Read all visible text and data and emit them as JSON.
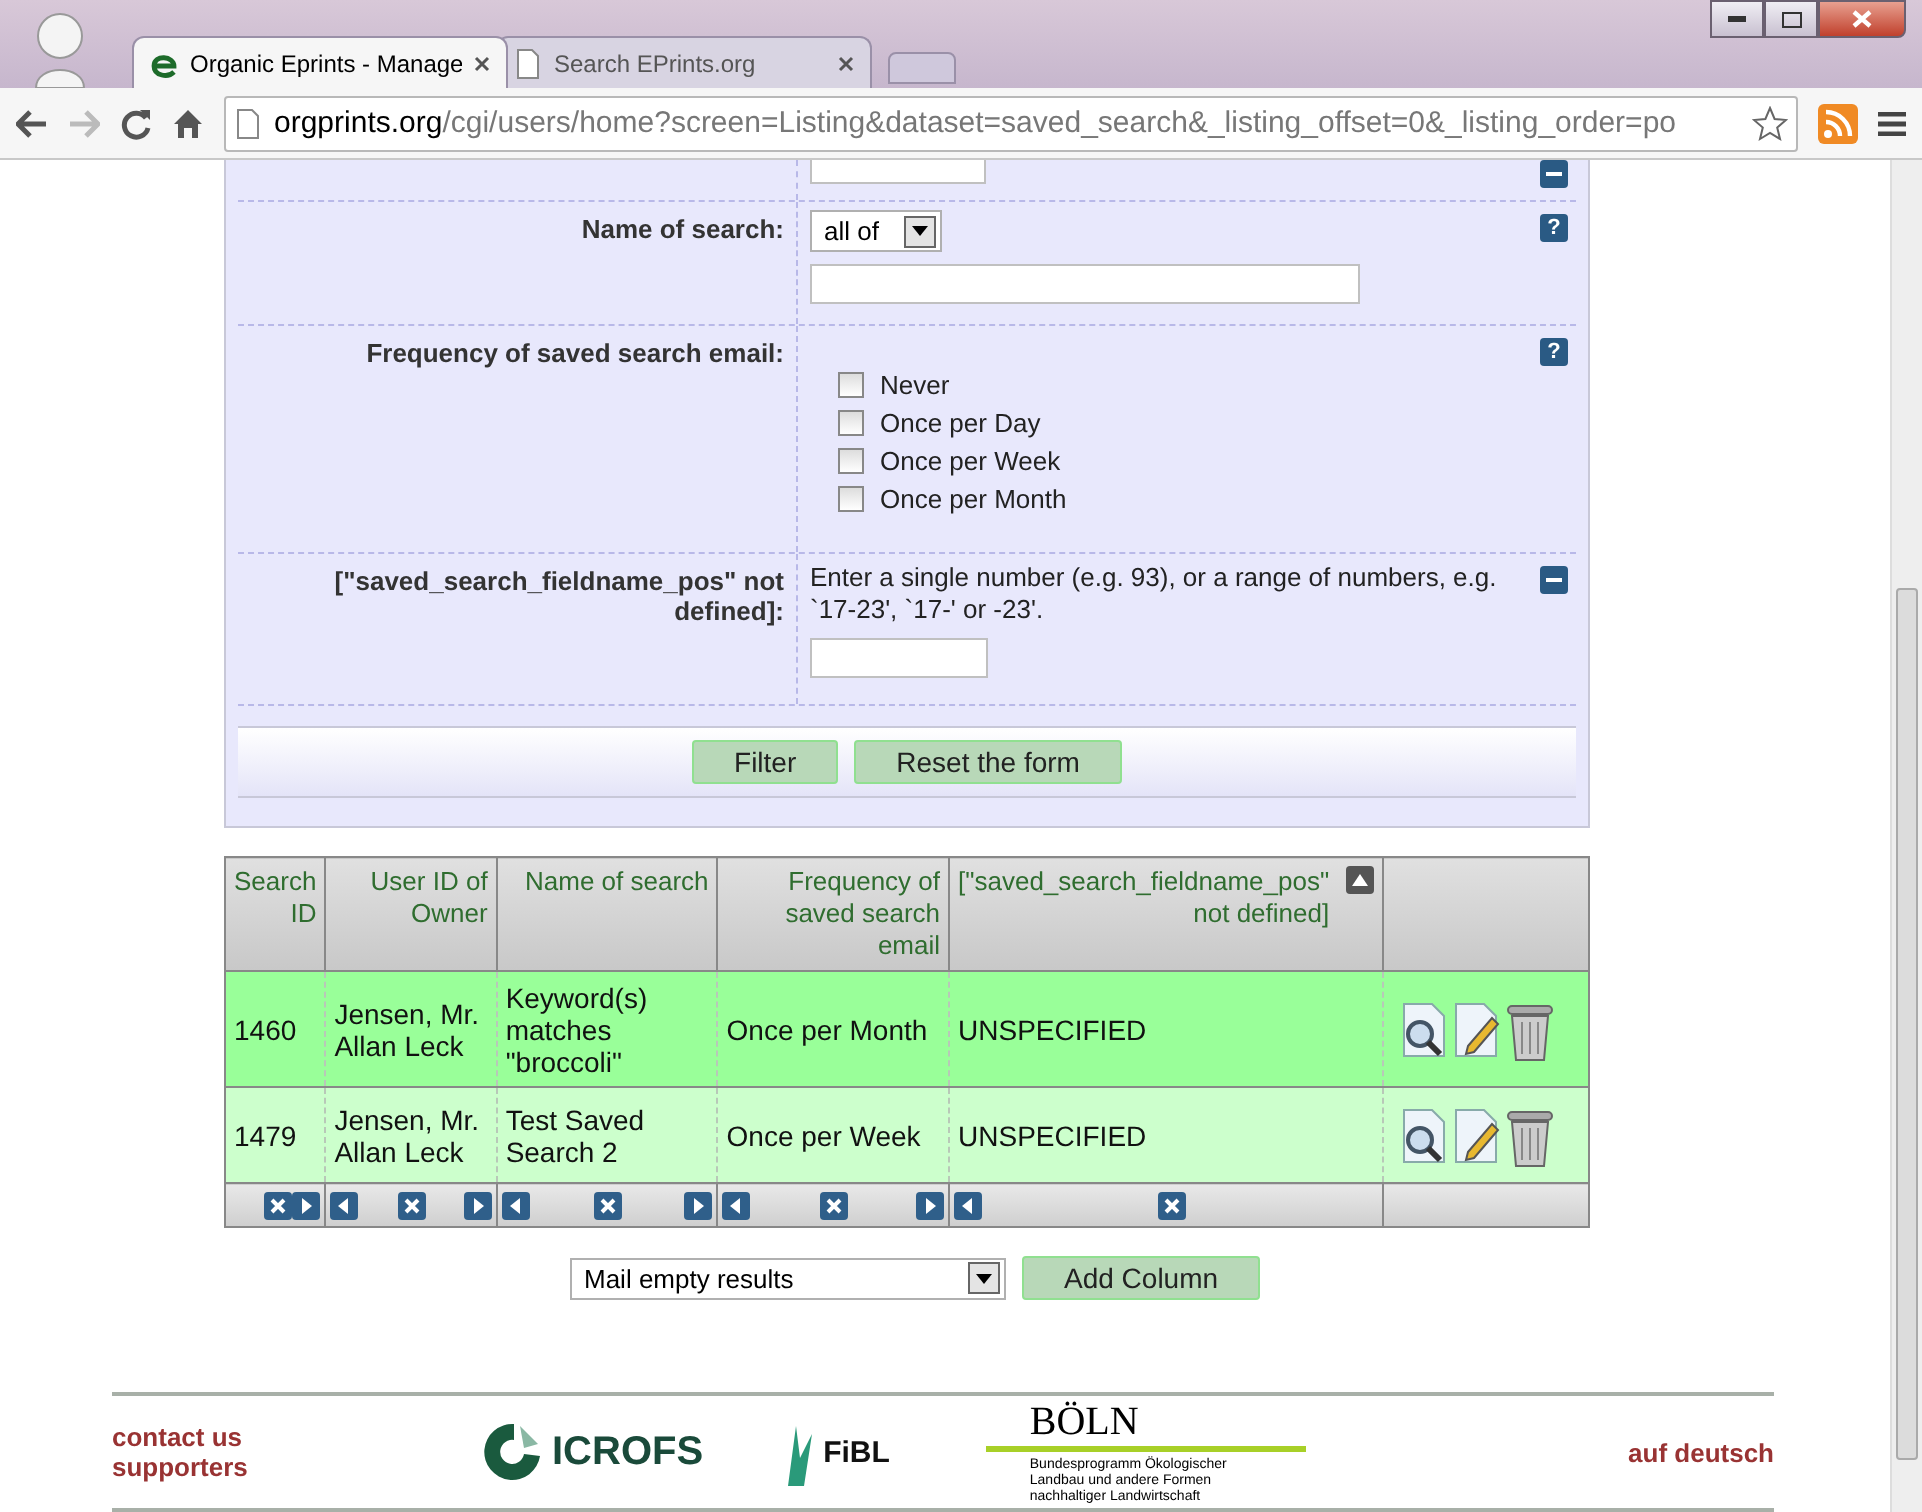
{
  "browser": {
    "tabs": [
      {
        "title": "Organic Eprints - Manage",
        "selected": true
      },
      {
        "title": "Search EPrints.org",
        "selected": false
      }
    ],
    "url": {
      "host": "orgprints.org",
      "path": "/cgi/users/home?screen=Listing&dataset=saved_search&_listing_offset=0&_listing_order=po"
    }
  },
  "form": {
    "rows": [
      {
        "kind": "partial",
        "icon": {
          "kind": "collapse"
        }
      },
      {
        "kind": "select",
        "label": "Name of search:",
        "select": "all of",
        "icon": {
          "kind": "help",
          "glyph": "?"
        }
      },
      {
        "kind": "checkboxes",
        "label": "Frequency of saved search email:",
        "options": [
          {
            "label": "Never",
            "checked": false
          },
          {
            "label": "Once per Day",
            "checked": false
          },
          {
            "label": "Once per Week",
            "checked": false
          },
          {
            "label": "Once per Month",
            "checked": false
          }
        ],
        "icon": {
          "kind": "help",
          "glyph": "?"
        }
      },
      {
        "kind": "range",
        "label": "[\"saved_search_fieldname_pos\" not defined]:",
        "hint": "Enter a single number (e.g. 93), or a range of numbers, e.g. `17-23', `17-' or -23'.",
        "icon": {
          "kind": "collapse"
        }
      }
    ],
    "buttons": [
      "Filter",
      "Reset the form"
    ]
  },
  "table": {
    "columns": [
      {
        "label": "Search ID",
        "move_left": false,
        "move_right": true,
        "sorted": false
      },
      {
        "label": "User ID of Owner",
        "move_left": true,
        "move_right": true,
        "sorted": false
      },
      {
        "label": "Name of search",
        "move_left": true,
        "move_right": true,
        "sorted": false
      },
      {
        "label": "Frequency of saved search email",
        "move_left": true,
        "move_right": true,
        "sorted": false
      },
      {
        "label": "[\"saved_search_fieldname_pos\" not defined]",
        "move_left": true,
        "move_right": false,
        "sorted": true
      }
    ],
    "rows": [
      {
        "highlighted": true,
        "cells": [
          "1460",
          "Jensen, Mr. Allan Leck",
          "Keyword(s) matches \"broccoli\"",
          "Once per Month",
          "UNSPECIFIED"
        ]
      },
      {
        "highlighted": false,
        "cells": [
          "1479",
          "Jensen, Mr. Allan Leck",
          "Test Saved Search 2",
          "Once per Week",
          "UNSPECIFIED"
        ]
      }
    ]
  },
  "add_column": {
    "select": "Mail empty results",
    "button": "Add Column"
  },
  "footer": {
    "links": [
      "contact us",
      "supporters"
    ],
    "logos": {
      "icrofs": "ICROFS",
      "fibl": "FiBL",
      "boln": "BÖLN",
      "boln_caption": "Bundesprogramm Ökologischer Landbau und andere Formen nachhaltiger Landwirtschaft"
    },
    "language": "auf deutsch"
  }
}
